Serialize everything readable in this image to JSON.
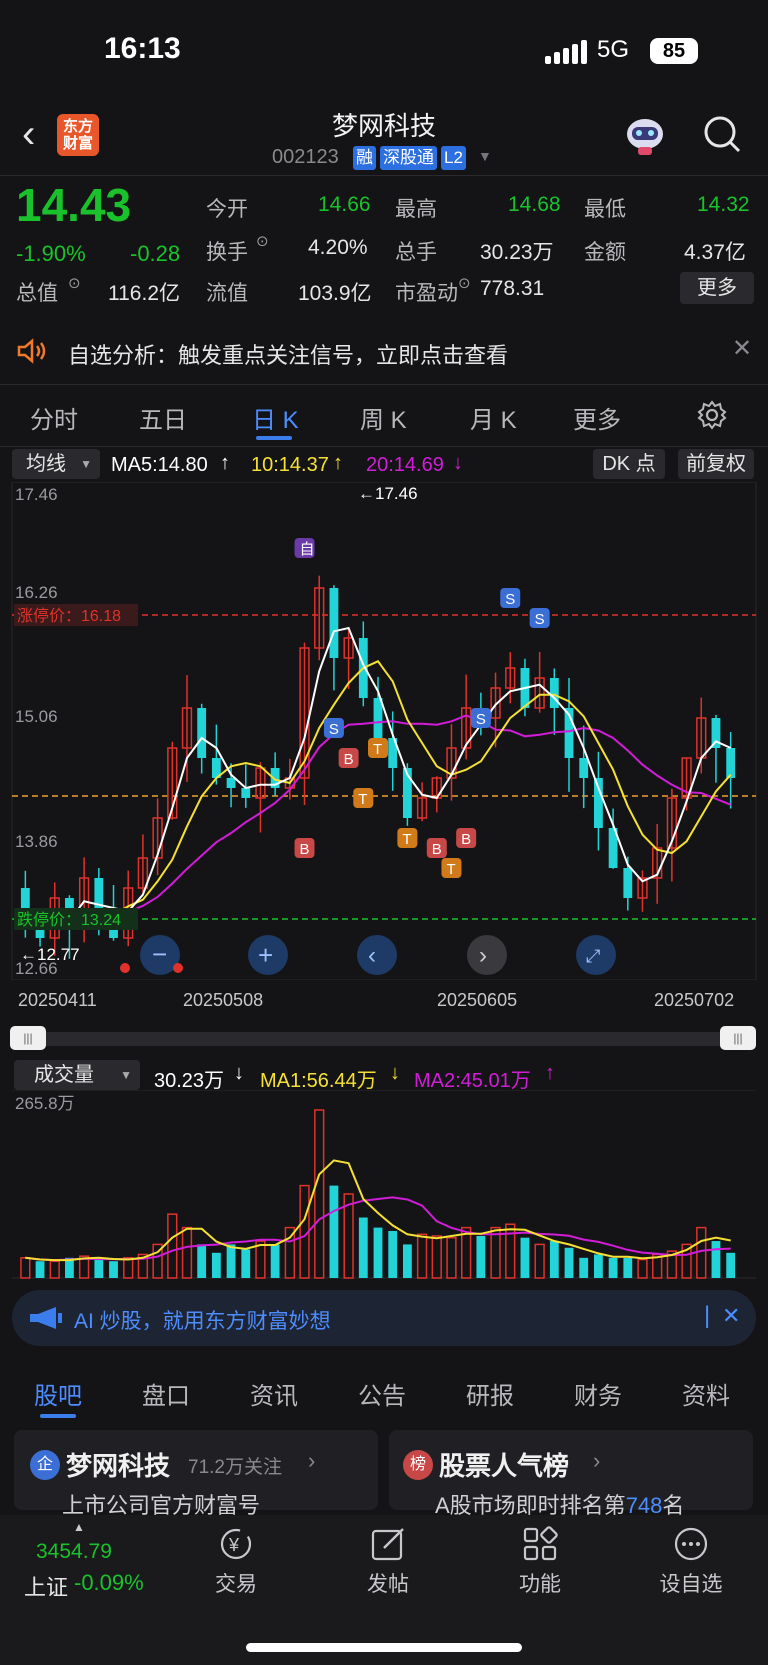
{
  "status": {
    "time": "16:13",
    "network": "5G",
    "battery": "85"
  },
  "header": {
    "logo": "东方财富",
    "title": "梦网科技",
    "code": "002123",
    "tags": [
      "融",
      "深股通",
      "L2"
    ]
  },
  "quote": {
    "price": "14.43",
    "change_pct": "-1.90%",
    "change": "-0.28",
    "rows": [
      [
        {
          "label": "今开",
          "value": "14.66",
          "green": true
        },
        {
          "label": "最高",
          "value": "14.68",
          "green": true
        },
        {
          "label": "最低",
          "value": "14.32",
          "green": true
        }
      ],
      [
        {
          "label": "换手",
          "value": "4.20%"
        },
        {
          "label": "总手",
          "value": "30.23万"
        },
        {
          "label": "金额",
          "value": "4.37亿"
        }
      ],
      [
        {
          "label": "总值",
          "value": "116.2亿"
        },
        {
          "label": "流值",
          "value": "103.9亿"
        },
        {
          "label": "市盈动",
          "value": "778.31"
        }
      ]
    ],
    "more": "更多"
  },
  "notice": {
    "text": "自选分析：触发重点关注信号，立即点击查看"
  },
  "period_tabs": [
    "分时",
    "五日",
    "日 K",
    "周 K",
    "月 K",
    "更多"
  ],
  "active_tab": "日 K",
  "kline_toolbar": {
    "indicator": "均线",
    "ma5": "MA5:14.80",
    "ma10": "10:14.37",
    "ma20": "20:14.69",
    "dk": "DK 点",
    "adjust": "前复权"
  },
  "kline": {
    "price_labels": [
      "17.46",
      "16.26",
      "15.06",
      "13.86",
      "12.66"
    ],
    "limit_up": "涨停价：16.18",
    "limit_down": "跌停价：13.24",
    "high_marker": "17.46",
    "low_marker": "12.77",
    "date_labels": [
      "20250411",
      "20250508",
      "20250605",
      "20250702"
    ],
    "signal_marks": {
      "self": "自",
      "buy": "B",
      "sell": "S",
      "t": "T"
    }
  },
  "volume": {
    "indicator": "成交量",
    "vol": "30.23万",
    "ma1": "MA1:56.44万",
    "ma2": "MA2:45.01万",
    "top_label": "265.8万"
  },
  "ai_banner": {
    "text": "AI 炒股，就用东方财富妙想"
  },
  "info_tabs": [
    "股吧",
    "盘口",
    "资讯",
    "公告",
    "研报",
    "财务",
    "资料"
  ],
  "cards": [
    {
      "icon": "企",
      "title": "梦网科技",
      "meta": "71.2万关注",
      "sub": "上市公司官方财富号"
    },
    {
      "icon": "榜",
      "title": "股票人气榜",
      "sub_prefix": "A股市场即时排名第",
      "rank": "748",
      "sub_suffix": "名"
    }
  ],
  "bottom_nav": {
    "index_value": "3454.79",
    "index_name": "上证",
    "index_change": "-0.09%",
    "items": [
      "交易",
      "发帖",
      "功能",
      "设自选"
    ]
  },
  "colors": {
    "up": "#e0322b",
    "down": "#22d3d8",
    "green": "#19c22b",
    "ma5": "#ffffff",
    "ma10": "#f5e133",
    "ma20": "#d21dd8",
    "accent": "#3b7ded"
  }
}
